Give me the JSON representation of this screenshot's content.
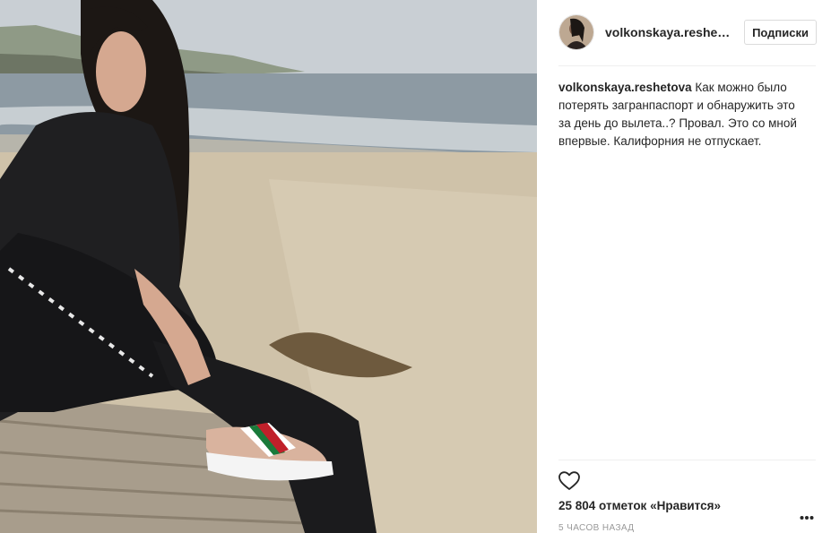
{
  "post": {
    "image_description_icon": "beach-photo",
    "author": "volkonskaya.reshetova",
    "author_short": "volkonskaya.reshet...",
    "follow_label": "Подписки",
    "caption_author": "volkonskaya.reshetova",
    "caption_text": "Как можно было потерять загранпаспорт и обнаружить это за день до вылета..? Провал. Это со мной впервые. Калифорния не отпускает.",
    "likes": "25 804 отметок «Нравится»",
    "time_ago": "5 часов назад"
  },
  "icons": {
    "like": "heart-icon",
    "more": "more-options-icon"
  }
}
